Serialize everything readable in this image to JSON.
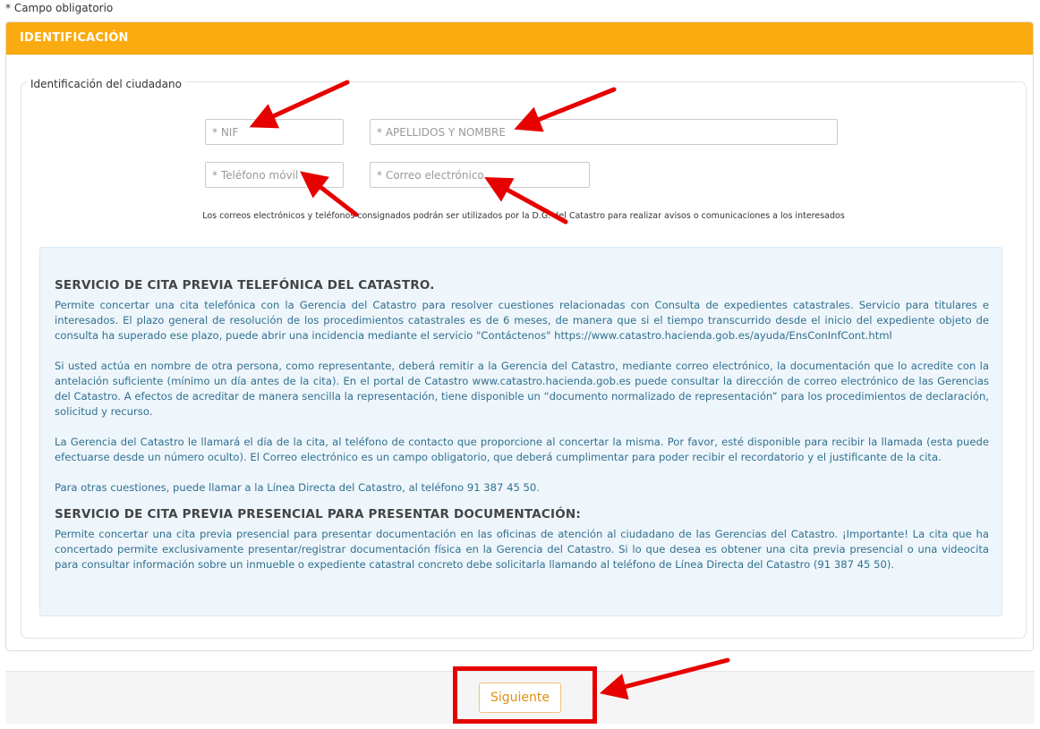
{
  "required_note": "* Campo obligatorio",
  "panel": {
    "title": "IDENTIFICACIÓN"
  },
  "fieldset": {
    "legend": "Identificación del ciudadano"
  },
  "fields": {
    "nif": {
      "placeholder": "* NIF",
      "value": ""
    },
    "name": {
      "placeholder": "* APELLIDOS Y NOMBRE",
      "value": ""
    },
    "phone": {
      "placeholder": "* Teléfono móvil",
      "value": ""
    },
    "email": {
      "placeholder": "* Correo electrónico",
      "value": ""
    }
  },
  "consent_note": "Los correos electrónicos y teléfonos consignados podrán ser utilizados por la D.G. del Catastro para realizar avisos o comunicaciones a los interesados",
  "info": {
    "phone_title": "SERVICIO DE CITA PREVIA TELEFÓNICA DEL CATASTRO.",
    "p1": "Permite concertar una cita telefónica con la Gerencia del Catastro para resolver cuestiones relacionadas con Consulta de expedientes catastrales. Servicio para titulares e interesados. El plazo general de resolución de los procedimientos catastrales es de 6 meses, de manera que si el tiempo transcurrido desde el inicio del expediente objeto de consulta ha superado ese plazo, puede abrir una incidencia mediante el servicio \"Contáctenos\" https://www.catastro.hacienda.gob.es/ayuda/EnsConInfCont.html",
    "p2": "Si usted actúa en nombre de otra persona, como representante, deberá remitir a la Gerencia del Catastro, mediante correo electrónico, la documentación que lo acredite con la antelación suficiente (mínimo un día antes de la cita). En el portal de Catastro www.catastro.hacienda.gob.es puede consultar la dirección de correo electrónico de las Gerencias del Catastro. A efectos de acreditar de manera sencilla la representación, tiene disponible un “documento normalizado de representación” para los procedimientos de declaración, solicitud y recurso.",
    "p3": "La Gerencia del Catastro le llamará el día de la cita, al teléfono de contacto que proporcione al concertar la misma. Por favor, esté disponible para recibir la llamada (esta puede efectuarse desde un número oculto). El Correo electrónico es un campo obligatorio, que deberá cumplimentar para poder recibir el recordatorio y el justificante de la cita.",
    "p4": "Para otras cuestiones, puede llamar a la Línea Directa del Catastro, al teléfono 91 387 45 50.",
    "presencial_title": "SERVICIO DE CITA PREVIA PRESENCIAL PARA PRESENTAR DOCUMENTACIÓN:",
    "p5": "Permite concertar una cita previa presencial para presentar documentación en las oficinas de atención al ciudadano de las Gerencias del Catastro. ¡Importante! La cita que ha concertado permite exclusivamente presentar/registrar documentación física en la Gerencia del Catastro. Si lo que desea es obtener una cita previa presencial o una videocita para consultar información sobre un inmueble o expediente catastral concreto debe solicitarla llamando al teléfono de Línea Directa del Catastro (91 387 45 50)."
  },
  "footer": {
    "next_label": "Siguiente"
  },
  "colors": {
    "header": "#fbaa0f",
    "annotation": "#e60000",
    "info_bg": "#eef6fc"
  }
}
